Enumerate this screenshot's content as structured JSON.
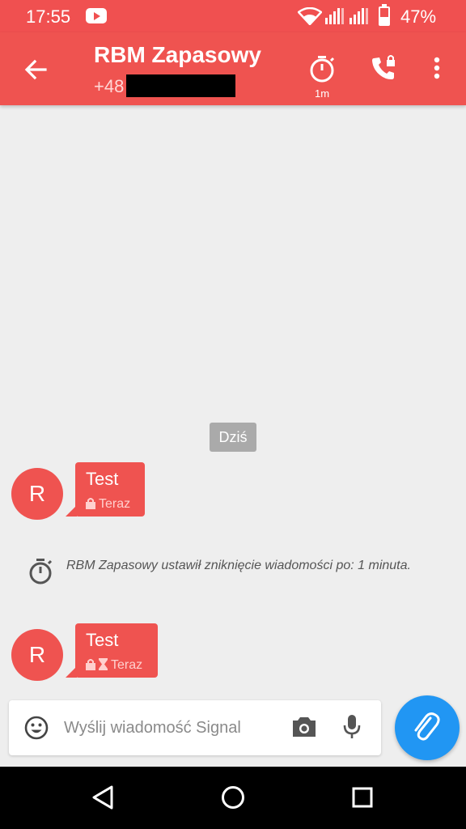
{
  "status_bar": {
    "time": "17:55",
    "battery": "47%",
    "icons": [
      "youtube-icon",
      "wifi-icon",
      "signal-icon",
      "signal-icon",
      "battery-icon"
    ]
  },
  "toolbar": {
    "title": "RBM Zapasowy",
    "subtitle": "+48",
    "timer_label": "1m",
    "color": "#ef5350"
  },
  "conversation": {
    "date_divider": "Dziś",
    "messages": [
      {
        "avatar": "R",
        "text": "Test",
        "time": "Teraz",
        "icons": [
          "lock-icon"
        ]
      },
      {
        "avatar": "R",
        "text": "Test",
        "time": "Teraz",
        "icons": [
          "lock-icon",
          "hourglass-icon"
        ]
      }
    ],
    "update": "RBM Zapasowy ustawił zniknięcie wiadomości po: 1 minuta."
  },
  "compose": {
    "placeholder": "Wyślij wiadomość Signal"
  },
  "colors": {
    "accent": "#ef5350",
    "fab": "#2196f3",
    "background": "#eeeeee"
  }
}
